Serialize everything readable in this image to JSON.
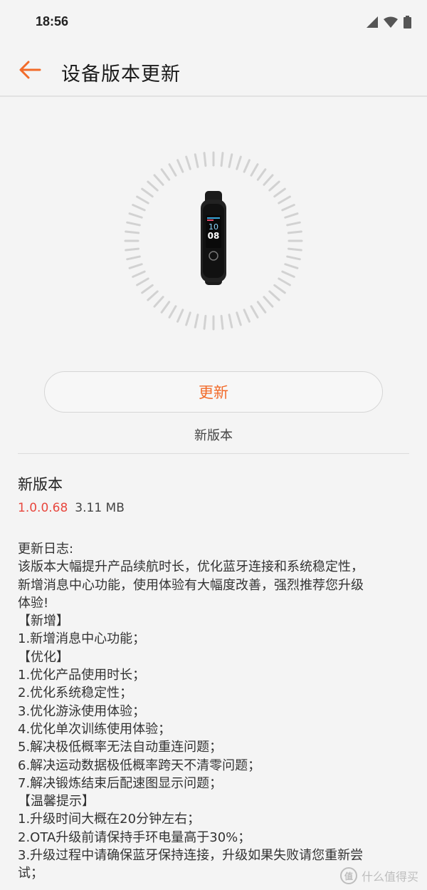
{
  "status_bar": {
    "time": "18:56"
  },
  "header": {
    "title": "设备版本更新"
  },
  "device": {
    "screen_hour": "10",
    "screen_minute": "08"
  },
  "update_button": {
    "label": "更新"
  },
  "version_caption": "新版本",
  "details": {
    "section_title": "新版本",
    "version": "1.0.0.68",
    "size": "3.11 MB"
  },
  "changelog": [
    "更新日志:",
    "该版本大幅提升产品续航时长，优化蓝牙连接和系统稳定性，",
    "新增消息中心功能，使用体验有大幅度改善，强烈推荐您升级",
    "体验!",
    "【新增】",
    "1.新增消息中心功能；",
    "【优化】",
    "1.优化产品使用时长；",
    "2.优化系统稳定性；",
    "3.优化游泳使用体验；",
    "4.优化单次训练使用体验；",
    "5.解决极低概率无法自动重连问题；",
    "6.解决运动数据极低概率跨天不清零问题；",
    "7.解决锻炼结束后配速图显示问题；",
    "【温馨提示】",
    "1.升级时间大概在20分钟左右；",
    "2.OTA升级前请保持手环电量高于30%；",
    "3.升级过程中请确保蓝牙保持连接，升级如果失败请您重新尝",
    "试；"
  ],
  "watermark": {
    "badge": "值",
    "text": "什么值得买"
  },
  "colors": {
    "accent": "#f26b2a",
    "version": "#e8473e"
  }
}
